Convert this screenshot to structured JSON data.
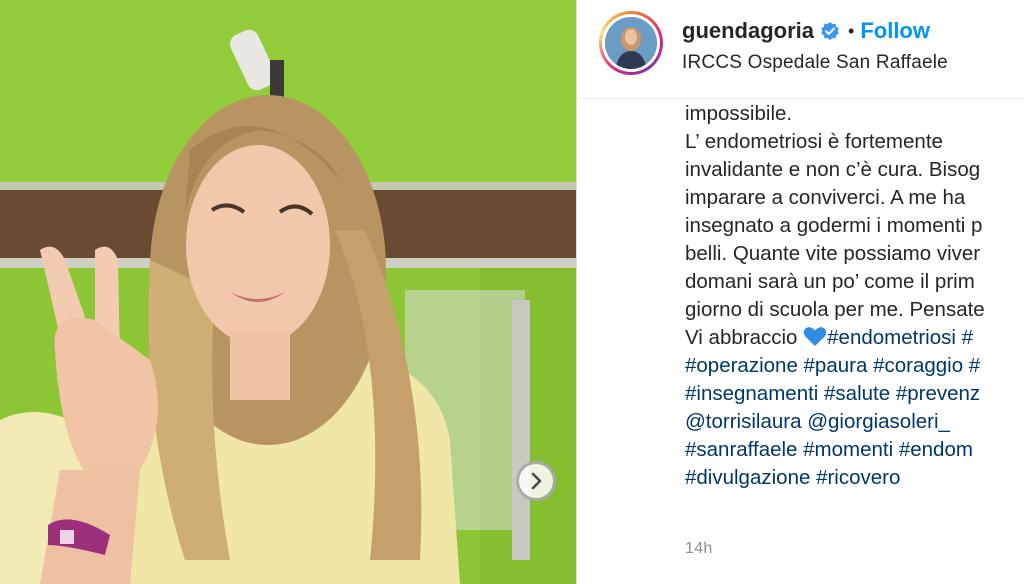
{
  "post": {
    "carousel_next_icon": "chevron-right-icon"
  },
  "header": {
    "username": "guendagoria",
    "verified_icon": "verified-badge-icon",
    "separator": "•",
    "follow_label": "Follow",
    "location": "IRCCS Ospedale San Raffaele"
  },
  "caption": {
    "line1": "impossibile.",
    "line2": "L’ endometriosi è fortemente",
    "line3": "invalidante e non c’è cura. Bisog",
    "line4": "imparare a conviverci. A me ha",
    "line5": "insegnato a godermi i momenti p",
    "line6": "belli. Quante vite possiamo viver",
    "line7": "domani sarà un po’ come il prim",
    "line8": "giorno di scuola per me. Pensate",
    "line9_text": "Vi abbraccio ",
    "line9_tag1": "#endometriosi",
    "line9_tag2": " #",
    "line10_tags": "#operazione #paura #coraggio #",
    "line11_tags": "#insegnamenti #salute #prevenz",
    "line12_tags": "@torrisilaura @giorgiasoleri_",
    "line13_tags": "#sanraffaele #momenti #endom",
    "line14_tags": "#divulgazione #ricovero",
    "heart_icon": "blue-heart-icon"
  },
  "timestamp": "14h",
  "colors": {
    "link": "#00376b",
    "follow": "#0095f6",
    "text": "#262626",
    "muted": "#8e8e8e",
    "wall_green": "#8cc634"
  }
}
